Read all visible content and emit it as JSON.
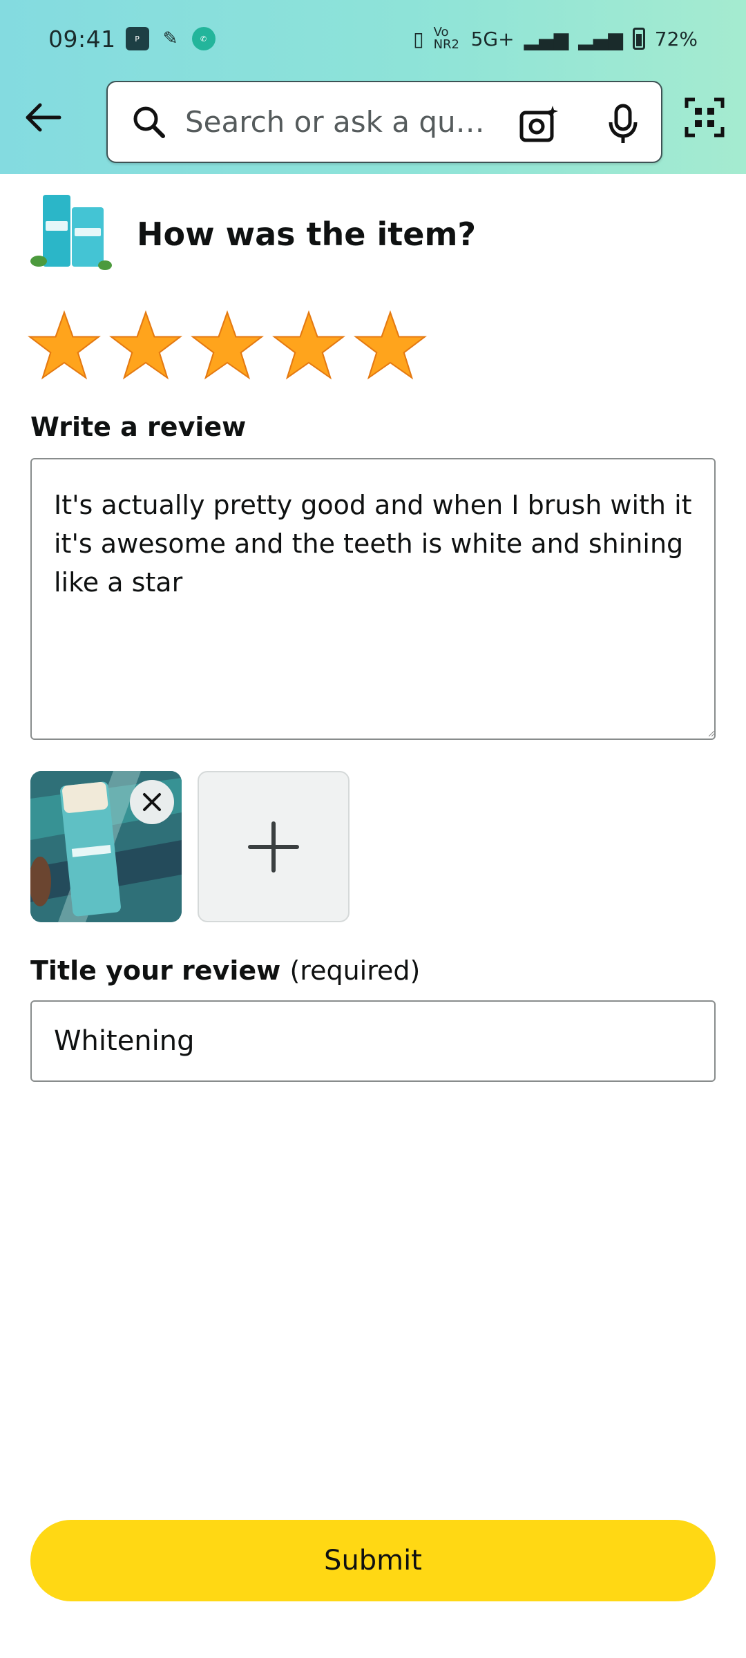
{
  "status_bar": {
    "time": "09:41",
    "network": "5G+",
    "volte": "Vo NR2",
    "battery": "72%",
    "notification_icons": [
      "paytm-icon",
      "app-icon",
      "whatsapp-business-icon"
    ]
  },
  "header": {
    "search_placeholder": "Search or ask a que…",
    "icons": [
      "back-arrow-icon",
      "search-icon",
      "camera-icon",
      "microphone-icon",
      "qr-scan-icon"
    ]
  },
  "product": {
    "question": "How was the item?"
  },
  "rating": {
    "value": 5,
    "max": 5,
    "star_color": "#ffa41c"
  },
  "review": {
    "label": "Write a review",
    "text": "It's actually pretty good and when I brush with it it's awesome and the teeth is white and shining like a star"
  },
  "photos": {
    "count": 1
  },
  "title_field": {
    "label": "Title your review",
    "hint": "(required)",
    "value": "Whitening"
  },
  "submit": {
    "label": "Submit",
    "color": "#ffd814"
  },
  "colors": {
    "header_start": "#84dbe0",
    "header_end": "#a5ebd0",
    "border": "#888c8c"
  }
}
